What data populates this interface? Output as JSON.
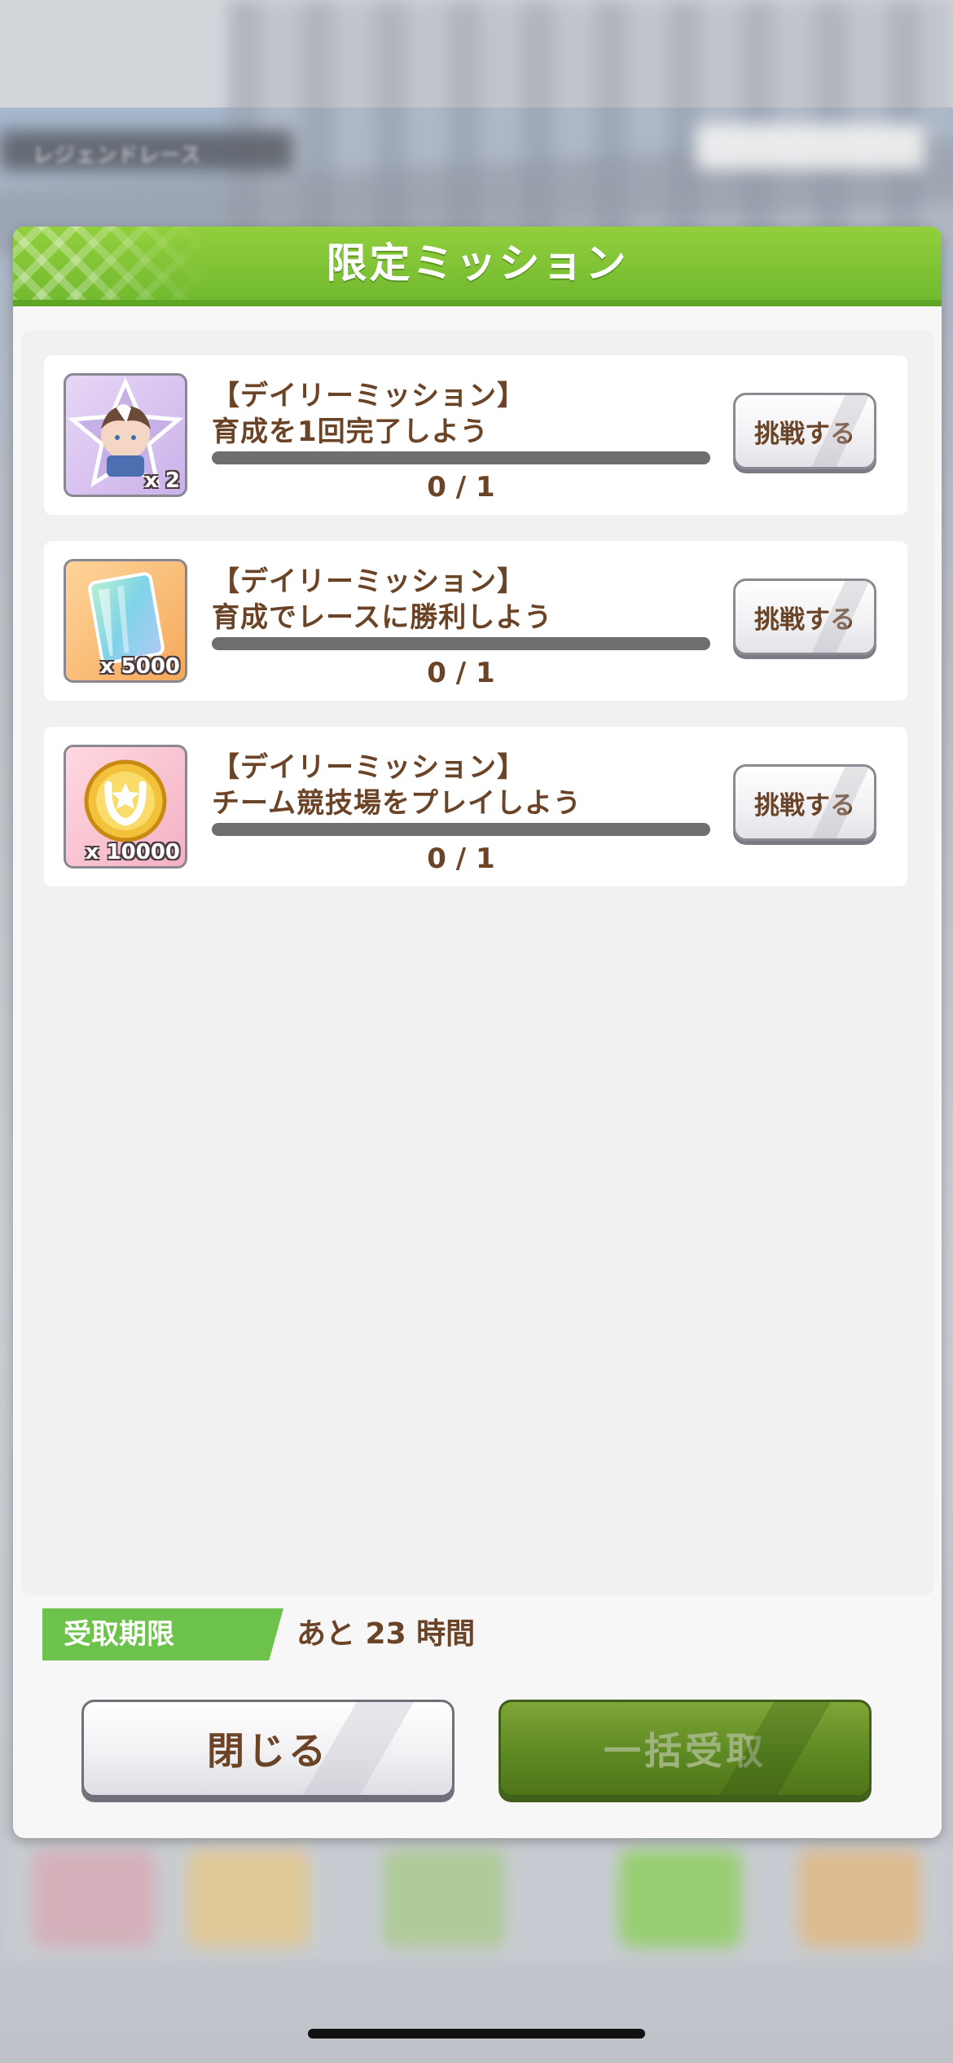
{
  "background": {
    "race_label": "レジェンドレース",
    "colors": {
      "accent_green": "#6fb82e",
      "text_brown": "#6b4326"
    }
  },
  "dialog": {
    "title": "限定ミッション",
    "missions": [
      {
        "title_line1": "【デイリーミッション】",
        "title_line2": "育成を1回完了しよう",
        "reward_icon": "character-piece-icon",
        "reward_qty": "x 2",
        "progress_text": "0 / 1",
        "progress_fraction": 0,
        "button_label": "挑戦する"
      },
      {
        "title_line1": "【デイリーミッション】",
        "title_line2": "育成でレースに勝利しよう",
        "reward_icon": "crystal-card-icon",
        "reward_qty": "x 5000",
        "progress_text": "0 / 1",
        "progress_fraction": 0,
        "button_label": "挑戦する"
      },
      {
        "title_line1": "【デイリーミッション】",
        "title_line2": "チーム競技場をプレイしよう",
        "reward_icon": "gold-coin-icon",
        "reward_qty": "x 10000",
        "progress_text": "0 / 1",
        "progress_fraction": 0,
        "button_label": "挑戦する"
      }
    ],
    "deadline_label": "受取期限",
    "deadline_value": "あと 23 時間",
    "close_label": "閉じる",
    "claim_all_label": "一括受取"
  }
}
